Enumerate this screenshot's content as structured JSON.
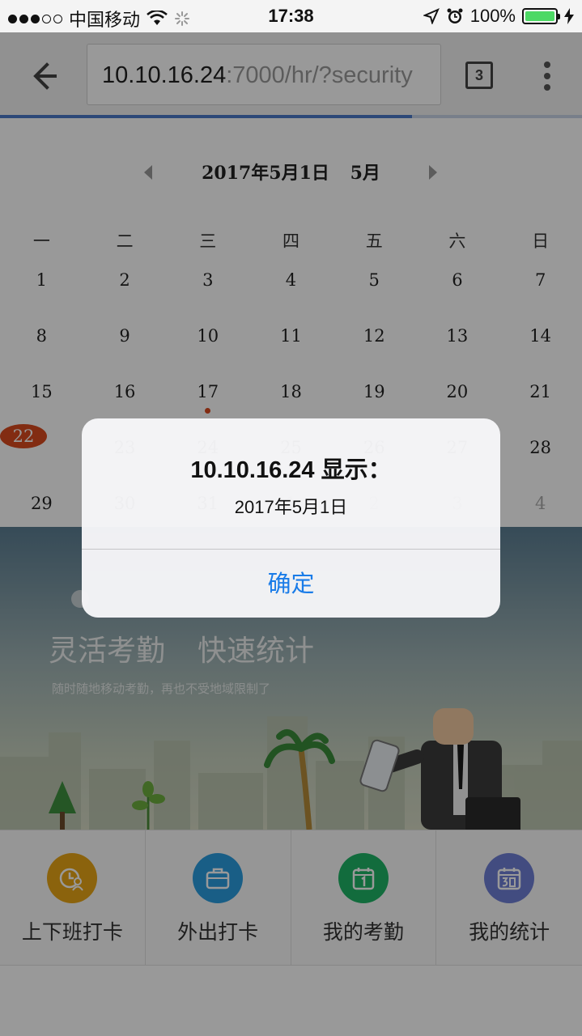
{
  "status_bar": {
    "carrier": "中国移动",
    "time": "17:38",
    "battery": "100%"
  },
  "browser": {
    "url_host": "10.10.16.24",
    "url_rest": ":7000/hr/?security",
    "tab_count": "3",
    "load_progress": 0.708
  },
  "calendar": {
    "header_date": "2017年5月1日",
    "header_month": "5月",
    "weekdays": [
      "一",
      "二",
      "三",
      "四",
      "五",
      "六",
      "日"
    ],
    "weeks": [
      [
        "1",
        "2",
        "3",
        "4",
        "5",
        "6",
        "7"
      ],
      [
        "8",
        "9",
        "10",
        "11",
        "12",
        "13",
        "14"
      ],
      [
        "15",
        "16",
        "17",
        "18",
        "19",
        "20",
        "21"
      ],
      [
        "22",
        "23",
        "24",
        "25",
        "26",
        "27",
        "28"
      ],
      [
        "29",
        "30",
        "31",
        "1",
        "2",
        "3",
        "4"
      ]
    ],
    "today": "22",
    "marked_day": "17"
  },
  "banner": {
    "title_1": "灵活考勤",
    "title_2": "快速统计",
    "subtitle": "随时随地移动考勤，再也不受地域限制了"
  },
  "bottom_nav": [
    {
      "label": "上下班打卡",
      "icon": "clock-person-icon",
      "color": "#e8a617"
    },
    {
      "label": "外出打卡",
      "icon": "briefcase-icon",
      "color": "#2a9de0"
    },
    {
      "label": "我的考勤",
      "icon": "calendar-1-icon",
      "color": "#1fb566"
    },
    {
      "label": "我的统计",
      "icon": "calendar-30-icon",
      "color": "#6f7fd6"
    }
  ],
  "alert": {
    "title": "10.10.16.24 显示：",
    "message": "2017年5月1日",
    "ok_label": "确定"
  }
}
